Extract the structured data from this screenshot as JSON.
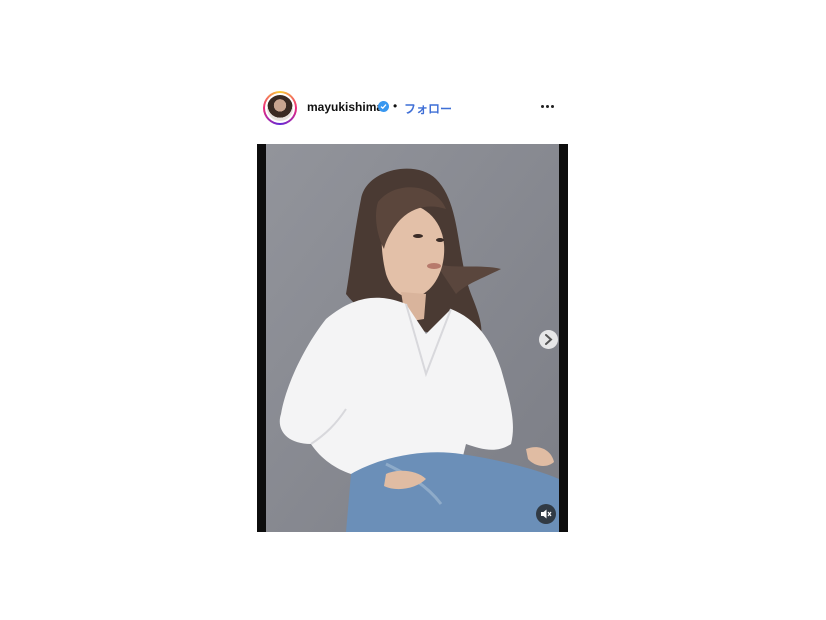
{
  "header": {
    "username": "mayukishima",
    "verified": true,
    "separator": "•",
    "follow_label": "フォロー"
  },
  "icons": {
    "avatar": "profile-avatar",
    "verified": "verified-badge-icon",
    "more": "more-options-icon",
    "next": "chevron-right-icon",
    "mute": "speaker-muted-icon"
  },
  "colors": {
    "follow": "#3f6fd6",
    "verified": "#3897f0",
    "photo_background": "#8b8d95"
  }
}
